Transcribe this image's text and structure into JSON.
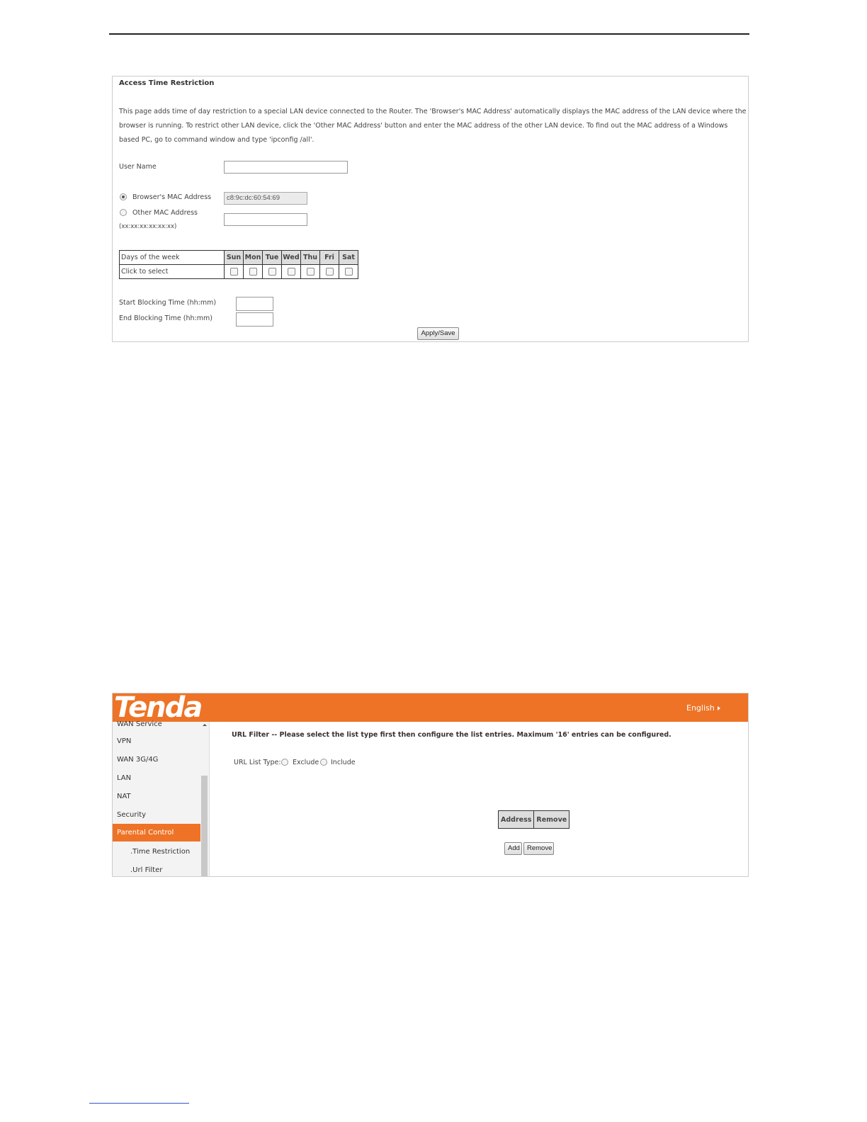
{
  "panel1": {
    "title": "Access Time Restriction",
    "description": "This page adds time of day restriction to a special LAN device connected to the Router. The 'Browser's MAC Address' automatically displays the MAC address of the LAN device where the browser is running. To restrict other LAN device, click the 'Other MAC Address' button and enter the MAC address of the other LAN device. To find out the MAC address of a Windows based PC, go to command window and type 'ipconfig /all'.",
    "user_name_label": "User Name",
    "user_name_value": "",
    "browser_mac_label": "Browser's MAC Address",
    "browser_mac_value": "c8:9c:dc:60:54:69",
    "browser_mac_selected": true,
    "other_mac_label": "Other MAC Address",
    "other_mac_format": "(xx:xx:xx:xx:xx:xx)",
    "other_mac_value": "",
    "days_header": "Days of the week",
    "days_click": "Click to select",
    "days": [
      "Sun",
      "Mon",
      "Tue",
      "Wed",
      "Thu",
      "Fri",
      "Sat"
    ],
    "start_label": "Start Blocking Time (hh:mm)",
    "end_label": "End Blocking Time (hh:mm)",
    "apply_label": "Apply/Save"
  },
  "panel2": {
    "logo": "Tenda",
    "language": "English",
    "sidebar": [
      {
        "label": "WAN Service"
      },
      {
        "label": "VPN"
      },
      {
        "label": "WAN 3G/4G"
      },
      {
        "label": "LAN"
      },
      {
        "label": "NAT"
      },
      {
        "label": "Security"
      },
      {
        "label": "Parental Control",
        "active": true
      },
      {
        "label": ".Time Restriction"
      },
      {
        "label": ".Url Filter"
      }
    ],
    "url_title": "URL Filter -- Please select the list type first then configure the list entries. Maximum '16' entries can be configured.",
    "list_type_label": "URL List Type:",
    "exclude_label": "Exclude",
    "include_label": "Include",
    "table_headers": [
      "Address",
      "Remove"
    ],
    "add_label": "Add",
    "remove_label": "Remove"
  },
  "colors": {
    "accent": "#ee7326"
  }
}
